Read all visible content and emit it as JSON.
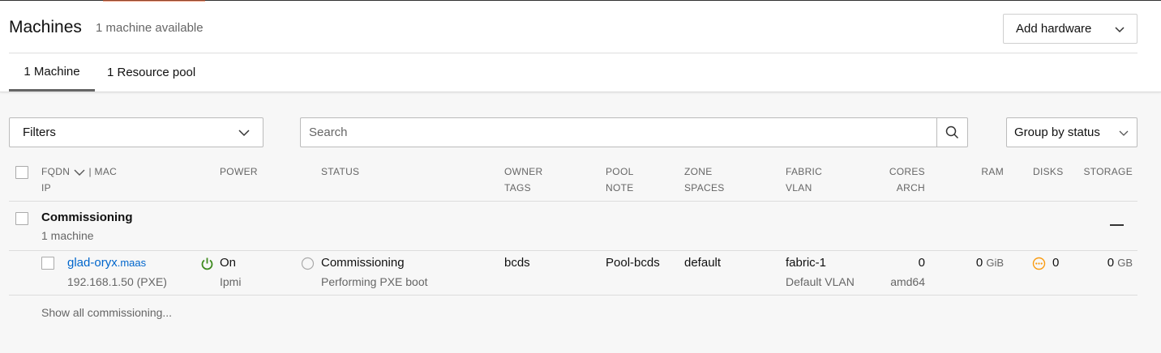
{
  "header": {
    "title": "Machines",
    "subtitle": "1 machine available",
    "add_hardware": "Add hardware",
    "tabs": [
      {
        "label": "1 Machine"
      },
      {
        "label": "1 Resource pool"
      }
    ]
  },
  "toolbar": {
    "filters": "Filters",
    "search_placeholder": "Search",
    "group_by": "Group by status"
  },
  "columns": {
    "fqdn": "FQDN",
    "mac": "| MAC",
    "ip": "IP",
    "power": "POWER",
    "status": "STATUS",
    "owner": "OWNER",
    "tags": "TAGS",
    "pool": "POOL",
    "note": "NOTE",
    "zone": "ZONE",
    "spaces": "SPACES",
    "fabric": "FABRIC",
    "vlan": "VLAN",
    "cores": "CORES",
    "arch": "ARCH",
    "ram": "RAM",
    "disks": "DISKS",
    "storage": "STORAGE"
  },
  "group": {
    "name": "Commissioning",
    "count": "1 machine"
  },
  "machine": {
    "hostname": "glad-oryx",
    "domain": ".maas",
    "ip": "192.168.1.50 (PXE)",
    "power_state": "On",
    "power_type": "Ipmi",
    "status": "Commissioning",
    "status_detail": "Performing PXE boot",
    "owner": "bcds",
    "pool": "Pool-bcds",
    "zone": "default",
    "fabric": "fabric-1",
    "vlan": "Default VLAN",
    "cores": "0",
    "arch": "amd64",
    "ram": "0",
    "ram_unit": "GiB",
    "disks": "0",
    "storage": "0",
    "storage_unit": "GB"
  },
  "show_all": "Show all commissioning...",
  "colors": {
    "accent": "#e95420",
    "link": "#0066cc",
    "power_on": "#3e8a1f",
    "warning": "#f99b11"
  }
}
